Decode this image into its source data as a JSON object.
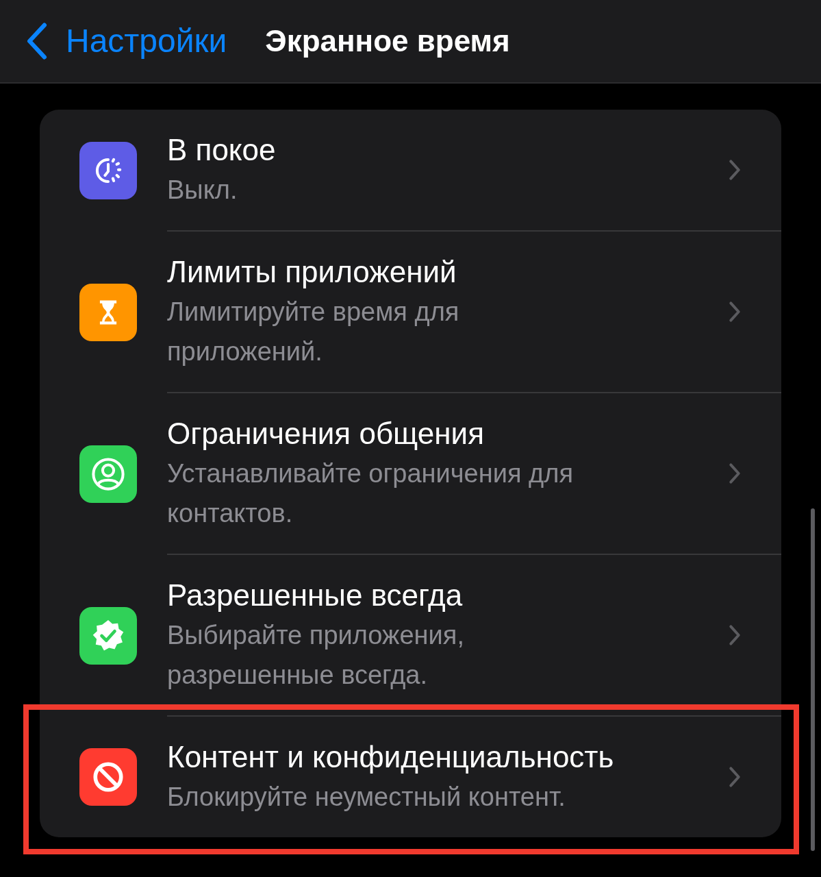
{
  "nav": {
    "back_label": "Настройки",
    "title": "Экранное время"
  },
  "items": [
    {
      "title": "В покое",
      "subtitle": "Выкл.",
      "kind": "downtime",
      "color": "#5e5ce6",
      "highlighted": false
    },
    {
      "title": "Лимиты приложений",
      "subtitle": "Лимитируйте время для приложений.",
      "kind": "hourglass",
      "color": "#ff9500",
      "highlighted": false
    },
    {
      "title": "Ограничения общения",
      "subtitle": "Устанавливайте ограничения для контактов.",
      "kind": "person",
      "color": "#30d158",
      "highlighted": false
    },
    {
      "title": "Разрешенные всегда",
      "subtitle": "Выбирайте приложения, разрешенные всегда.",
      "kind": "check",
      "color": "#30d158",
      "highlighted": false
    },
    {
      "title": "Контент и конфиденциальность",
      "subtitle": "Блокируйте неуместный контент.",
      "kind": "block",
      "color": "#ff3b30",
      "highlighted": true
    }
  ]
}
